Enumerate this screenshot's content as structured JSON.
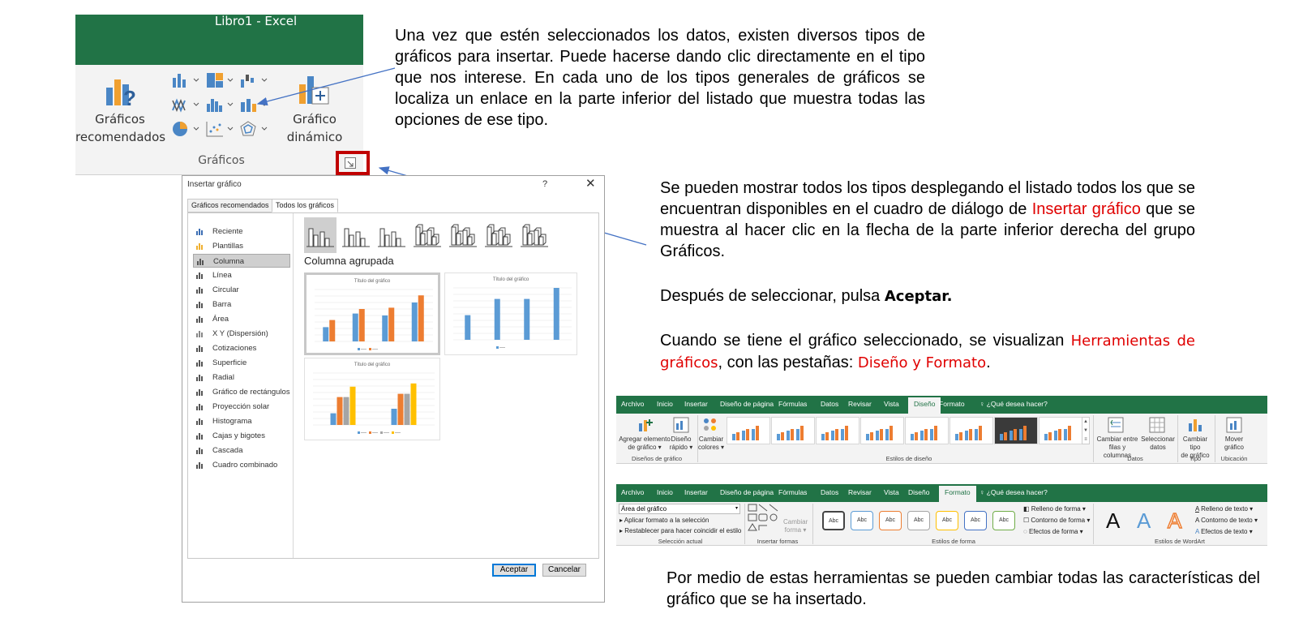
{
  "excel_ribbon": {
    "window_title": "Libro1 - Excel",
    "recommended_line1": "Gráficos",
    "recommended_line2": "recomendados",
    "pivot_line1": "Gráfico",
    "pivot_line2": "dinámico",
    "group_label": "Gráficos"
  },
  "text_blocks": {
    "p1": "Una vez que estén seleccionados los datos, existen diversos tipos de gráficos para insertar. Puede hacerse dando clic directamente en el tipo que nos interese. En cada uno de los tipos generales de gráficos se localiza un enlace en la parte inferior del listado que muestra todas las opciones de ese tipo.",
    "p2_a": "Se pueden mostrar todos los tipos desplegando el listado todos los que se encuentran disponibles en el cuadro de diálogo de",
    "p2_red": "Insertar gráfico",
    "p2_b": "que se muestra al hacer clic en la flecha de la parte inferior derecha del grupo Gráficos.",
    "p3_a": "Después de seleccionar, pulsa",
    "p3_bold": "Aceptar.",
    "p4_a": "Cuando se tiene el gráfico seleccionado, se visualizan",
    "p4_red1": "Herramientas de gráficos",
    "p4_b": ", con las pestañas:",
    "p4_red2": "Diseño y Formato",
    "p4_c": ".",
    "p5": "Por medio de estas herramientas se pueden cambiar todas las características del gráfico que se ha insertado."
  },
  "dialog": {
    "title": "Insertar gráfico",
    "help": "?",
    "close": "✕",
    "tabs": [
      "Gráficos recomendados",
      "Todos los gráficos"
    ],
    "chart_types": [
      "Reciente",
      "Plantillas",
      "Columna",
      "Línea",
      "Circular",
      "Barra",
      "Área",
      "X Y (Dispersión)",
      "Cotizaciones",
      "Superficie",
      "Radial",
      "Gráfico de rectángulos",
      "Proyección solar",
      "Histograma",
      "Cajas y bigotes",
      "Cascada",
      "Cuadro combinado"
    ],
    "selected_type": "Columna",
    "subtype_title": "Columna agrupada",
    "preview_title": "Título del gráfico",
    "ok": "Aceptar",
    "cancel": "Cancelar",
    "series_colors": [
      "#5b9bd5",
      "#ed7d31",
      "#a5a5a5",
      "#ffc000"
    ]
  },
  "design_ribbon": {
    "tabs": [
      "Archivo",
      "Inicio",
      "Insertar",
      "Diseño de página",
      "Fórmulas",
      "Datos",
      "Revisar",
      "Vista",
      "Diseño",
      "Formato",
      "♀ ¿Qué desea hacer?"
    ],
    "active_tab": "Diseño",
    "add_element_1": "Agregar elemento",
    "add_element_2": "de gráfico ▾",
    "quick_layout_1": "Diseño",
    "quick_layout_2": "rápido ▾",
    "change_colors_1": "Cambiar",
    "change_colors_2": "colores ▾",
    "switch_1": "Cambiar entre",
    "switch_2": "filas y columnas",
    "select_data_1": "Seleccionar",
    "select_data_2": "datos",
    "change_type_1": "Cambiar tipo",
    "change_type_2": "de gráfico",
    "move_1": "Mover",
    "move_2": "gráfico",
    "groups": [
      "Diseños de gráfico",
      "Estilos de diseño",
      "Datos",
      "Tipo",
      "Ubicación"
    ]
  },
  "format_ribbon": {
    "tabs": [
      "Archivo",
      "Inicio",
      "Insertar",
      "Diseño de página",
      "Fórmulas",
      "Datos",
      "Revisar",
      "Vista",
      "Diseño",
      "Formato",
      "♀ ¿Qué desea hacer?"
    ],
    "active_tab": "Formato",
    "selection_value": "Área del gráfico",
    "apply_format": "Aplicar formato a la selección",
    "reset": "Restablecer para hacer coincidir el estilo",
    "change_shape_1": "Cambiar",
    "change_shape_2": "forma ▾",
    "shape_fill": "Relleno de forma ▾",
    "shape_outline": "Contorno de forma ▾",
    "shape_effects": "Efectos de forma ▾",
    "abc": "Abc",
    "wordart_letter": "A",
    "text_fill": "Relleno de texto ▾",
    "text_outline": "Contorno de texto ▾",
    "text_effects": "Efectos de texto ▾",
    "groups": [
      "Selección actual",
      "Insertar formas",
      "Estilos de forma",
      "Estilos de WordArt"
    ]
  }
}
